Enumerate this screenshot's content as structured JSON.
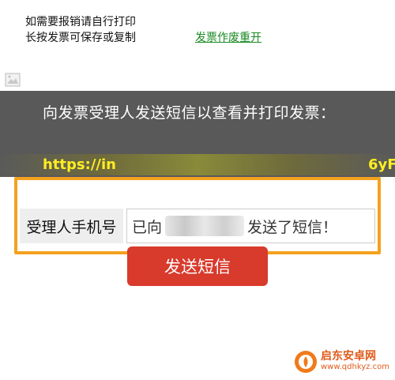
{
  "notice": {
    "line1": "如需要报销请自行打印",
    "line2": "长按发票可保存或复制"
  },
  "invoice_link_label": "发票作废重开",
  "panel": {
    "message": "向发票受理人发送短信以查看并打印发票：",
    "url_start": "https://in",
    "url_end": "6yF"
  },
  "phone_form": {
    "label": "受理人手机号",
    "status_prefix": "已向",
    "status_suffix": "发送了短信！"
  },
  "send_button_label": "发送短信",
  "watermark": {
    "title": "启东安卓网",
    "url": "www.qdhkyz.com"
  },
  "colors": {
    "panel_bg": "#595959",
    "url_text": "#ffee22",
    "highlight": "#f3a21e",
    "button_bg": "#d83a2c",
    "link": "#1a8a24"
  }
}
